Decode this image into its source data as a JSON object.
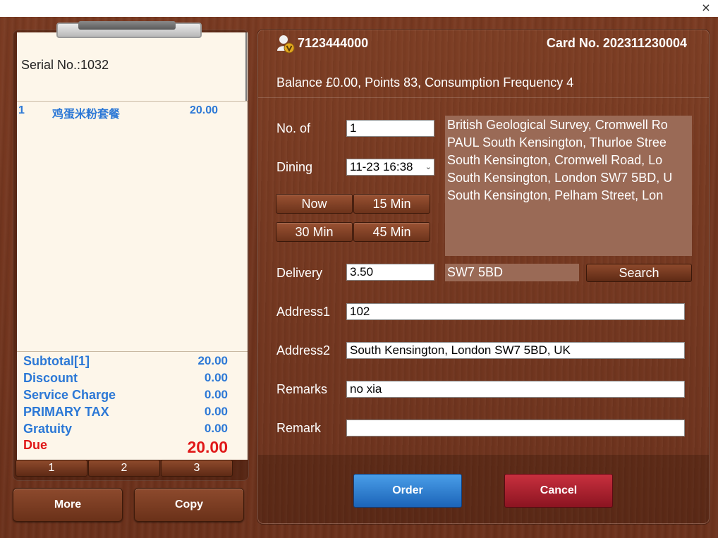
{
  "window": {
    "close_glyph": "×"
  },
  "receipt": {
    "serial": "Serial No.:1032",
    "items": [
      {
        "qty": "1",
        "name": "鸡蛋米粉套餐",
        "price": "20.00"
      }
    ],
    "summary": {
      "subtotal_label": "Subtotal[1]",
      "subtotal_value": "20.00",
      "discount_label": "Discount",
      "discount_value": "0.00",
      "service_label": "Service Charge",
      "service_value": "0.00",
      "tax_label": "PRIMARY TAX",
      "tax_value": "0.00",
      "gratuity_label": "Gratuity",
      "gratuity_value": "0.00",
      "due_label": "Due",
      "due_value": "20.00"
    },
    "pages": [
      "1",
      "2",
      "3"
    ]
  },
  "bottom_buttons": {
    "more": "More",
    "copy": "Copy"
  },
  "customer": {
    "phone": "7123444000",
    "card": "Card No. 202311230004",
    "balance": "Balance £0.00, Points 83, Consumption Frequency 4"
  },
  "form": {
    "no_of_label": "No. of",
    "no_of_value": "1",
    "dining_label": "Dining",
    "dining_value": "11-23 16:38",
    "time_buttons": [
      "Now",
      "15 Min",
      "30 Min",
      "45 Min"
    ],
    "delivery_label": "Delivery",
    "delivery_value": "3.50",
    "postcode": "SW7 5BD",
    "search": "Search",
    "address1_label": "Address1",
    "address1_value": "102",
    "address2_label": "Address2",
    "address2_value": "South Kensington, London SW7 5BD, UK",
    "remarks_label": "Remarks",
    "remarks_value": "no xia",
    "remark_label": "Remark",
    "remark_value": ""
  },
  "address_suggestions": [
    "British Geological Survey, Cromwell Ro",
    "PAUL South Kensington, Thurloe Stree",
    "South Kensington, Cromwell Road, Lo",
    "South Kensington, London SW7 5BD, U",
    "South Kensington, Pelham Street, Lon"
  ],
  "actions": {
    "order": "Order",
    "cancel": "Cancel"
  },
  "colors": {
    "item_blue": "#2c78d6",
    "due_red": "#e01818",
    "order_blue": "#1c64b8",
    "cancel_red": "#8c1421"
  }
}
